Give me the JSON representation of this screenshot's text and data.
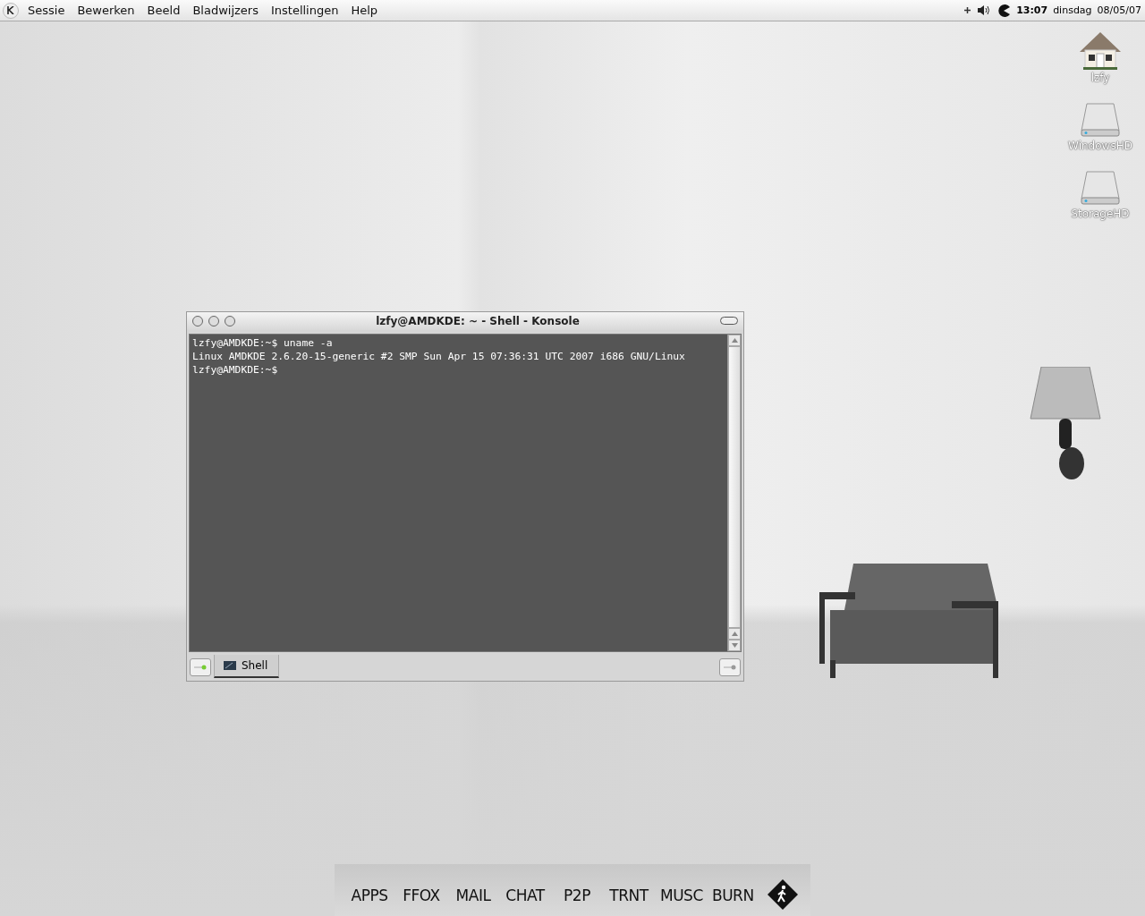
{
  "menu_bar": {
    "items": [
      "Sessie",
      "Bewerken",
      "Beeld",
      "Bladwijzers",
      "Instellingen",
      "Help"
    ],
    "clock": "13:07",
    "day": "dinsdag",
    "date": "08/05/07"
  },
  "desktop_icons": [
    {
      "label": "lzfy",
      "kind": "home"
    },
    {
      "label": "WindowsHD",
      "kind": "drive"
    },
    {
      "label": "StorageHD",
      "kind": "drive"
    }
  ],
  "konsole": {
    "title": "lzfy@AMDKDE: ~ - Shell - Konsole",
    "lines": [
      "lzfy@AMDKDE:~$ uname -a",
      "Linux AMDKDE 2.6.20-15-generic #2 SMP Sun Apr 15 07:36:31 UTC 2007 i686 GNU/Linux",
      "lzfy@AMDKDE:~$"
    ],
    "tabs": [
      {
        "label": "Shell",
        "selected": true
      }
    ]
  },
  "dock": {
    "items": [
      "APPS",
      "FFOX",
      "MAIL",
      "CHAT",
      "P2P",
      "TRNT",
      "MUSC",
      "BURN"
    ]
  }
}
